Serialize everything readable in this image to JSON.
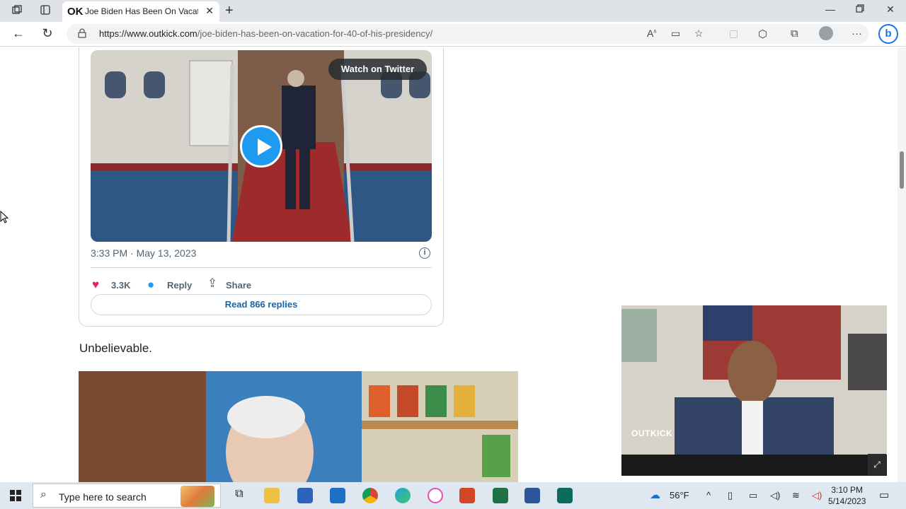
{
  "browser": {
    "tab_favicon": "OK",
    "tab_title": "Joe Biden Has Been On Vacation",
    "url_host": "https://www.outkick.com",
    "url_path": "/joe-biden-has-been-on-vacation-for-40-of-his-presidency/",
    "icons": [
      "workspaces-icon",
      "tab-actions-icon",
      "back-icon",
      "refresh-icon",
      "lock-icon",
      "read-aloud-icon",
      "reader-view-icon",
      "favorite-icon",
      "extensions-icon",
      "collections-icon",
      "profile-icon",
      "more-icon",
      "bing-icon"
    ]
  },
  "tweet": {
    "watch_label": "Watch on Twitter",
    "timestamp": "3:33 PM · May 13, 2023",
    "likes": "3.3K",
    "reply_label": "Reply",
    "share_label": "Share",
    "read_replies": "Read 866 replies",
    "accent_color": "#1d9bf0"
  },
  "article": {
    "paragraph": "Unbelievable."
  },
  "pip": {
    "logo": "OUTKICK"
  },
  "taskbar": {
    "search_placeholder": "Type here to search",
    "weather": "56°F",
    "time": "3:10 PM",
    "date": "5/14/2023"
  }
}
